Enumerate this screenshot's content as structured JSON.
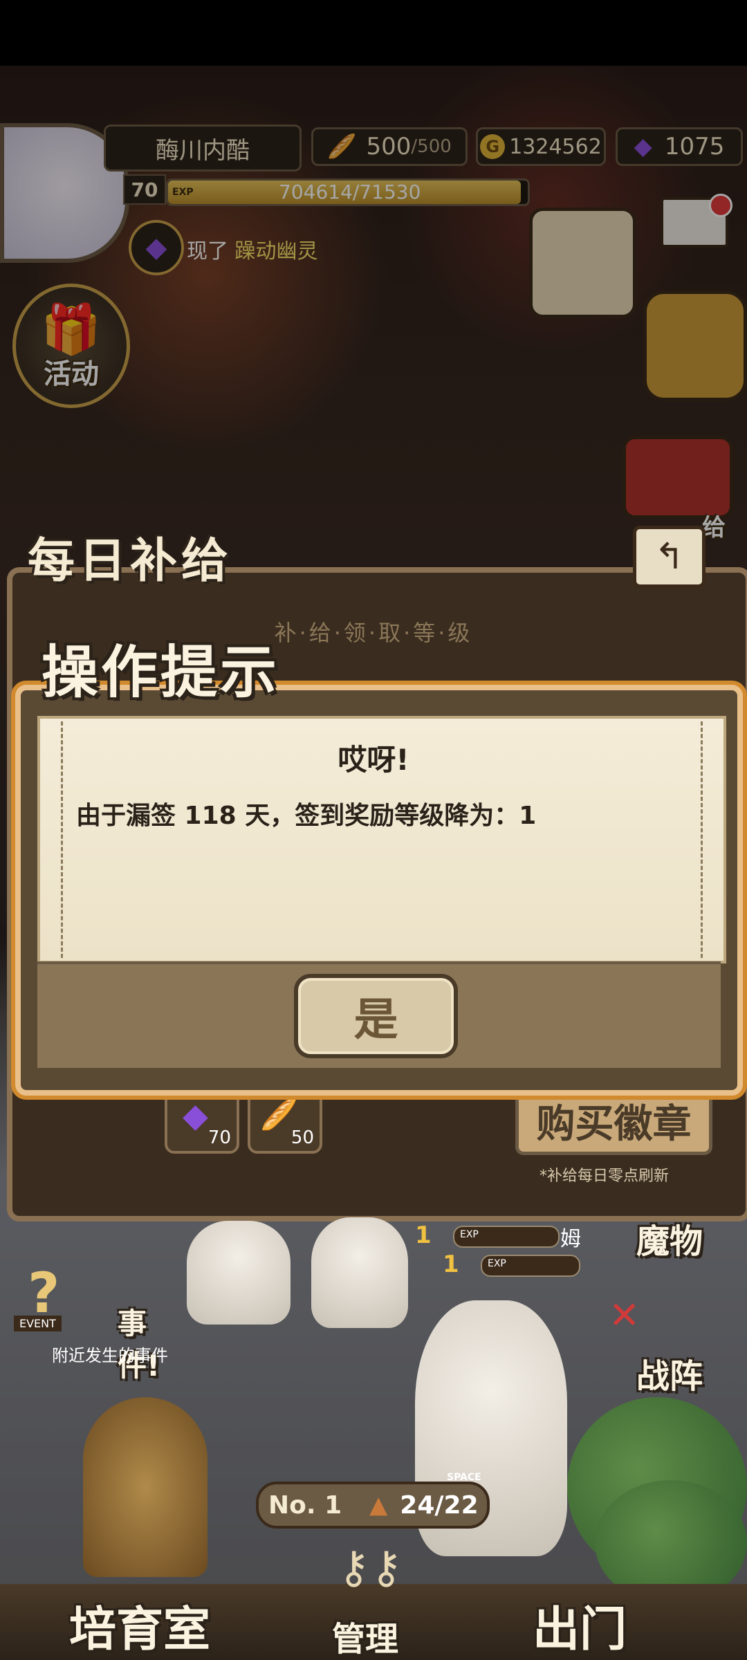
{
  "player": {
    "name": "酶川内酷",
    "level": "70",
    "exp_tag": "EXP",
    "exp_text": "704614/71530",
    "exp_fraction": 0.98
  },
  "resources": {
    "stamina": "500",
    "stamina_max": "/500",
    "gold": "1324562",
    "gems": "1075"
  },
  "notice": {
    "prefix": "现了",
    "highlight": "躁动幽灵"
  },
  "hud_buttons": {
    "activity": "活动",
    "supply_short": "给"
  },
  "supply_panel": {
    "title": "每日补给",
    "subtitle": "补·给·领·取·等·级",
    "slots": [
      {
        "icon": "purple-gem-icon",
        "count": "70"
      },
      {
        "icon": "bread-icon",
        "count": "50"
      }
    ],
    "buy_label": "购买徽章",
    "refresh_note": "*补给每日零点刷新"
  },
  "dialog": {
    "title": "操作提示",
    "heading": "哎呀!",
    "message": "由于漏签 118 天，签到奖励等级降为：1",
    "confirm_label": "是"
  },
  "field": {
    "exp_rows": [
      {
        "level": "1",
        "tag": "EXP",
        "suffix": "姆"
      },
      {
        "level": "1",
        "tag": "EXP",
        "suffix": ""
      }
    ],
    "event_tag": "EVENT",
    "event_title": "事件!",
    "event_sub": "附近发生的事件",
    "monster_label": "魔物",
    "formation_label": "战阵",
    "rank": "No. 1",
    "space_tag": "SPACE",
    "capacity": "24/22"
  },
  "bottom_nav": {
    "nursery": "培育室",
    "manage": "管理",
    "go_out": "出门"
  },
  "colors": {
    "accent_gold": "#c9a24a",
    "dialog_border": "#d28a2e",
    "notice_highlight": "#f7e36a"
  }
}
